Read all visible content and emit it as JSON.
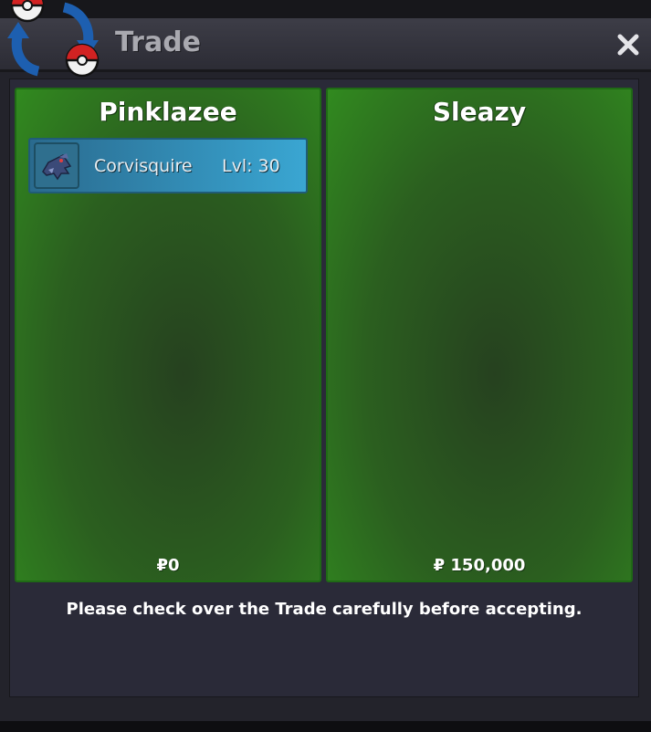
{
  "window": {
    "title": "Trade",
    "logo_icon": "trade-swap-icon",
    "close_icon": "close-icon"
  },
  "left_panel": {
    "player_name": "Pinklazee",
    "money_symbol": "₽",
    "money": "0",
    "items": [
      {
        "icon": "corvisquire-sprite-icon",
        "name": "Corvisquire",
        "level": "Lvl: 30"
      }
    ]
  },
  "right_panel": {
    "player_name": "Sleazy",
    "money_symbol": "₽",
    "money": "150,000",
    "items": []
  },
  "notice": "Please check over the Trade carefully before accepting.",
  "colors": {
    "panel_green": "#2b5f1f",
    "item_blue": "#328bb4",
    "window_bg": "#2a2a38"
  }
}
